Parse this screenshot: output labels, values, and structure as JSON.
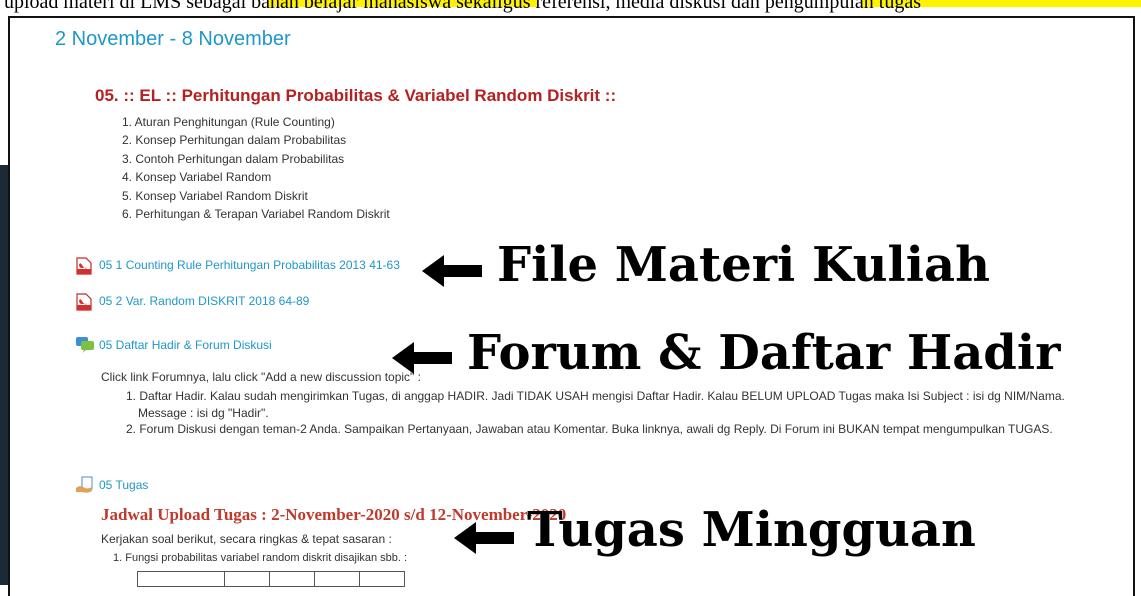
{
  "top_strip": {
    "text": "upload materi di LMS sebagai bahan belajar mahasiswa sekaligus referensi, media diskusi dan pengumpulan tugas"
  },
  "week": {
    "title": "2 November - 8 November"
  },
  "section": {
    "title": "05. :: EL :: Perhitungan Probabilitas & Variabel Random Diskrit ::",
    "topics": [
      "1. Aturan Penghitungan (Rule Counting)",
      "2. Konsep Perhitungan dalam Probabilitas",
      "3. Contoh Perhitungan dalam Probabilitas",
      "4. Konsep Variabel Random",
      "5. Konsep Variabel Random Diskrit",
      "6. Perhitungan & Terapan Variabel Random Diskrit"
    ]
  },
  "activities": {
    "file1": {
      "label": "05 1 Counting Rule Perhitungan Probabilitas 2013 41-63",
      "icon": "pdf-icon"
    },
    "file2": {
      "label": "05 2 Var. Random DISKRIT 2018 64-89",
      "icon": "pdf-icon"
    },
    "forum": {
      "label": "05 Daftar Hadir & Forum Diskusi",
      "icon": "forum-icon"
    },
    "assign": {
      "label": "05 Tugas",
      "icon": "assignment-icon"
    }
  },
  "forum_note": {
    "intro": "Click link Forumnya, lalu click \"Add a new discussion topic\" :",
    "rule1_line1": "1. Daftar Hadir. Kalau sudah mengirimkan Tugas, di anggap HADIR. Jadi TIDAK USAH mengisi Daftar Hadir. Kalau BELUM UPLOAD Tugas maka Isi Subject : isi dg NIM/Nama.",
    "rule1_line2": "Message : isi dg \"Hadir\".",
    "rule2": "2. Forum Diskusi dengan teman-2 Anda. Sampaikan Pertanyaan, Jawaban atau Komentar. Buka linknya, awali dg Reply. Di Forum ini BUKAN tempat mengumpulkan TUGAS."
  },
  "assignment": {
    "schedule": "Jadwal Upload Tugas : 2-November-2020 s/d 12-November-2020",
    "instruction": "Kerjakan soal berikut, secara ringkas & tepat sasaran :",
    "question1": "1.   Fungsi probabilitas variabel random diskrit disajikan sbb. :"
  },
  "annotations": {
    "a1": "File Materi Kuliah",
    "a2": "Forum & Daftar Hadir",
    "a3": "Tugas Mingguan"
  },
  "colors": {
    "link": "#1f97c9",
    "section_title": "#b52020",
    "highlight": "#fff200"
  }
}
